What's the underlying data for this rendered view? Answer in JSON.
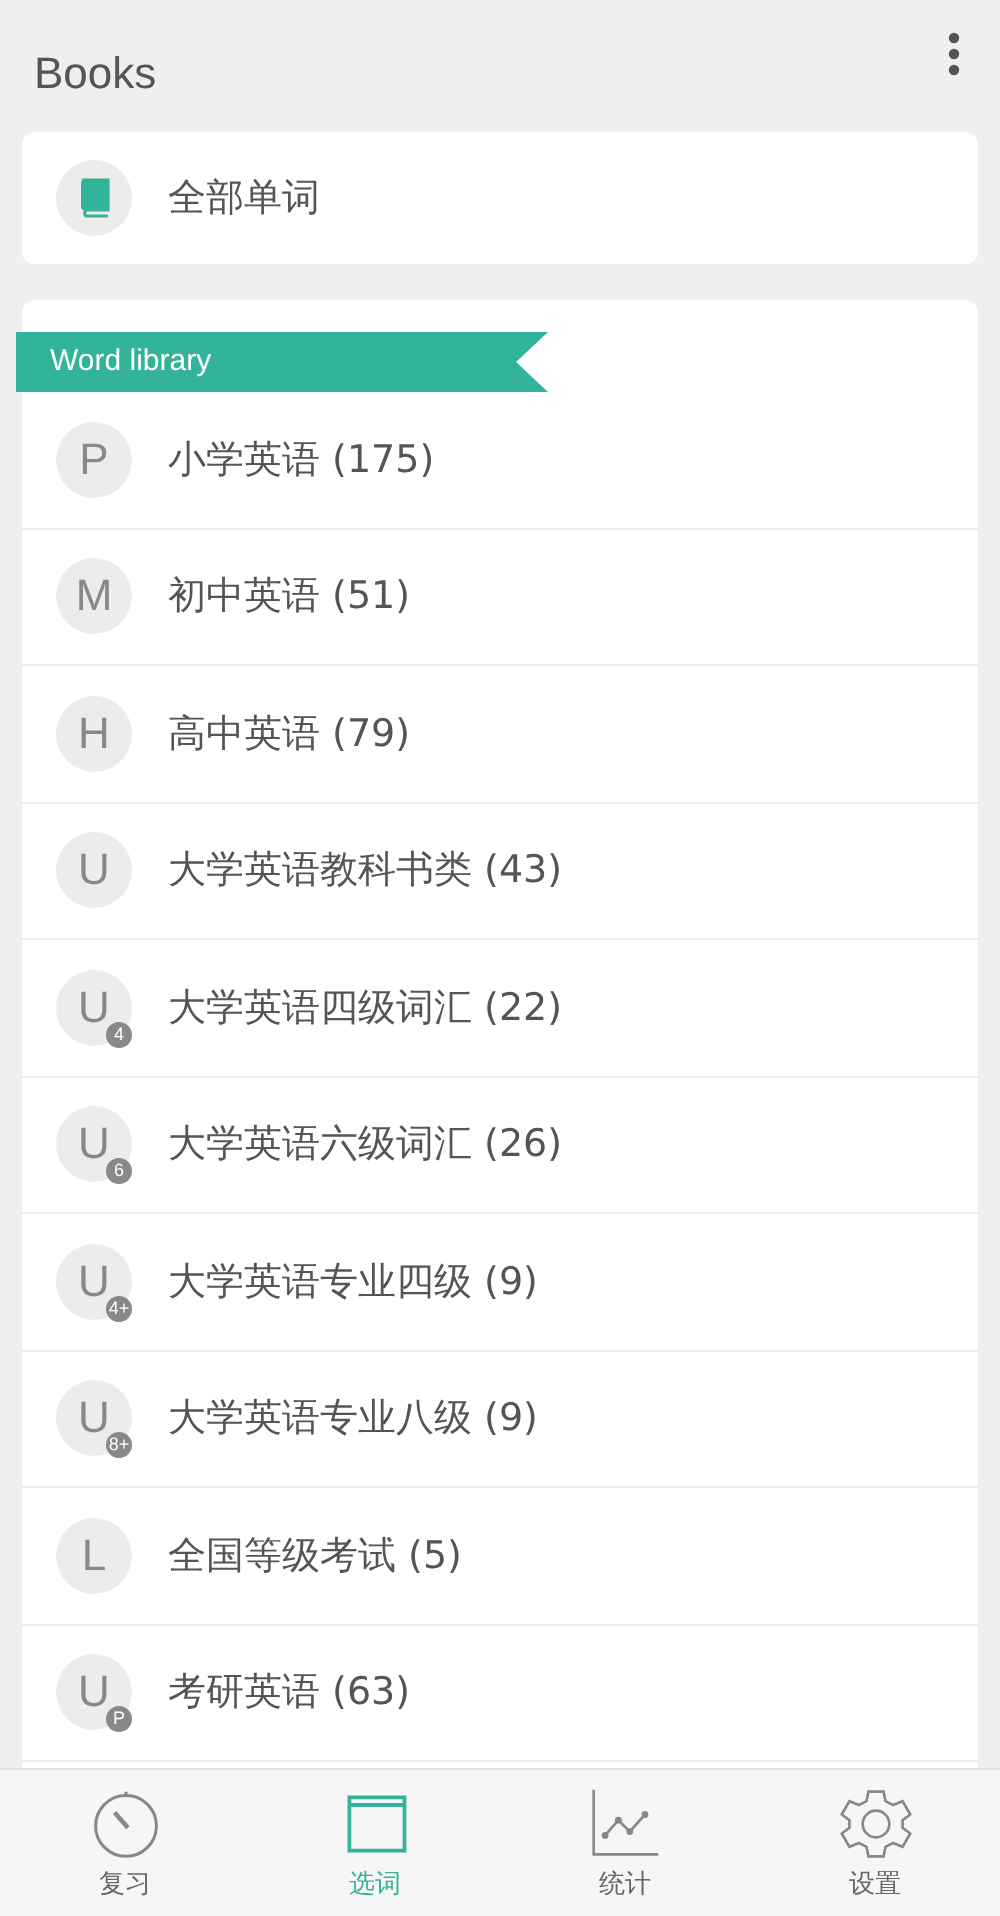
{
  "header": {
    "title": "Books"
  },
  "all_words": {
    "label": "全部单词"
  },
  "library": {
    "ribbon": "Word library",
    "items": [
      {
        "letter": "P",
        "label": "小学英语 (175)"
      },
      {
        "letter": "M",
        "label": "初中英语 (51)"
      },
      {
        "letter": "H",
        "label": "高中英语 (79)"
      },
      {
        "letter": "U",
        "label": "大学英语教科书类 (43)"
      },
      {
        "letter": "U",
        "badge": "4",
        "label": "大学英语四级词汇 (22)"
      },
      {
        "letter": "U",
        "badge": "6",
        "label": "大学英语六级词汇 (26)"
      },
      {
        "letter": "U",
        "badge": "4+",
        "label": "大学英语专业四级 (9)"
      },
      {
        "letter": "U",
        "badge": "8+",
        "label": "大学英语专业八级 (9)"
      },
      {
        "letter": "L",
        "label": "全国等级考试 (5)"
      },
      {
        "letter": "U",
        "badge": "P",
        "label": "考研英语 (63)"
      }
    ]
  },
  "nav": [
    {
      "kind": "review",
      "label": "复习",
      "selected": false
    },
    {
      "kind": "pick",
      "label": "选词",
      "selected": true
    },
    {
      "kind": "stats",
      "label": "统计",
      "selected": false
    },
    {
      "kind": "settings",
      "label": "设置",
      "selected": false
    }
  ]
}
